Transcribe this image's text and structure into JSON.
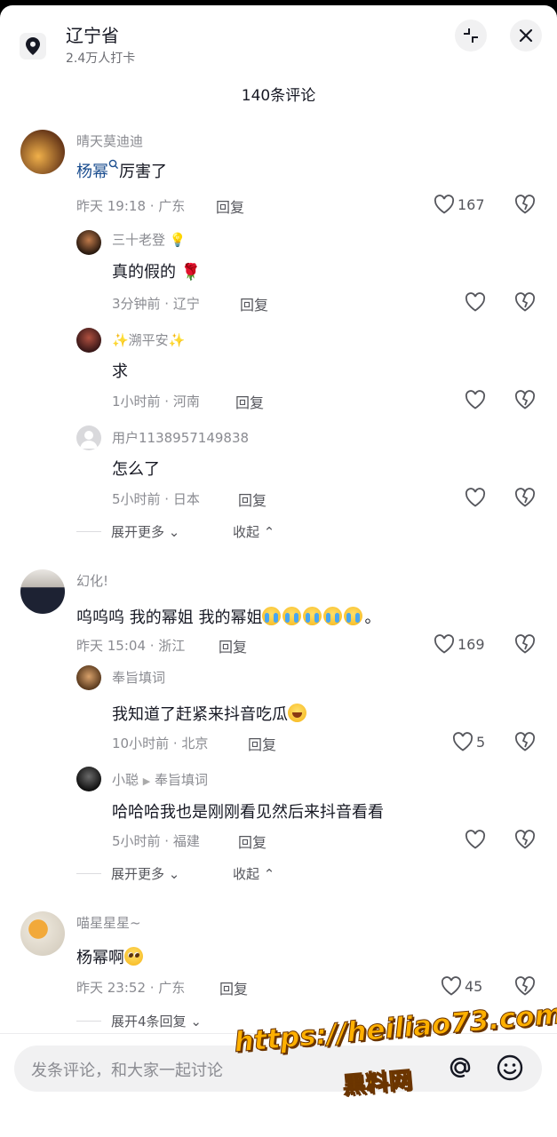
{
  "header": {
    "location_name": "辽宁省",
    "checkins": "2.4万人打卡",
    "comment_count": "140条评论"
  },
  "threads": [
    {
      "user": "晴天莫迪迪",
      "mention": "杨幂",
      "text": "厉害了",
      "meta": "昨天 19:18 · 广东",
      "reply_label": "回复",
      "likes": "167",
      "replies": [
        {
          "user": "三十老登",
          "text": "真的假的",
          "emoji": "rose",
          "meta": "3分钟前 · 辽宁",
          "reply_label": "回复"
        },
        {
          "user": "✨溯平安✨",
          "text": "求",
          "meta": "1小时前 · 河南",
          "reply_label": "回复"
        },
        {
          "user": "用户1138957149838",
          "text": "怎么了",
          "meta": "5小时前 · 日本",
          "reply_label": "回复"
        }
      ],
      "expand_more": "展开更多",
      "collapse": "收起"
    },
    {
      "user": "幻化!",
      "text": "呜呜呜 我的幂姐 我的幂姐",
      "text_suffix": "。",
      "emoji": "loudly-crying-face x5",
      "meta": "昨天 15:04 · 浙江",
      "reply_label": "回复",
      "likes": "169",
      "replies": [
        {
          "user": "奉旨填词",
          "text": "我知道了赶紧来抖音吃瓜",
          "emoji": "tears-of-joy",
          "meta": "10小时前 · 北京",
          "reply_label": "回复",
          "likes": "5"
        },
        {
          "user": "小聪",
          "reply_to": "奉旨填词",
          "text": "哈哈哈我也是刚刚看见然后来抖音看看",
          "meta": "5小时前 · 福建",
          "reply_label": "回复"
        }
      ],
      "expand_more": "展开更多",
      "collapse": "收起"
    },
    {
      "user": "喵星星星~",
      "text": "杨幂啊",
      "emoji": "pleading-face",
      "meta": "昨天 23:52 · 广东",
      "reply_label": "回复",
      "likes": "45",
      "expand_replies": "展开4条回复"
    }
  ],
  "input": {
    "placeholder": "发条评论，和大家一起讨论"
  },
  "watermark": {
    "line1": "https://heiliao73.com",
    "line2": "黑料网"
  },
  "colors": {
    "mention": "#1a4d8f",
    "watermark": "#ffb000",
    "sheet_bg": "#ffffff"
  }
}
